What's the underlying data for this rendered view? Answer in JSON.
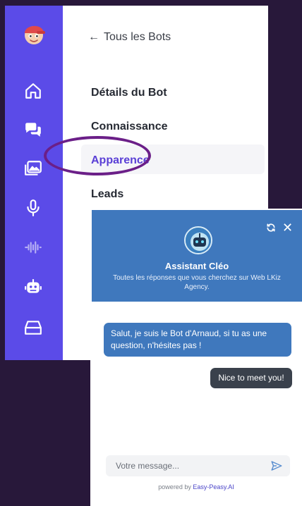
{
  "sidebar": {
    "icons": [
      "home-icon",
      "chat-bubbles-icon",
      "images-icon",
      "microphone-icon",
      "waveform-icon",
      "robot-icon",
      "inbox-icon"
    ]
  },
  "panel": {
    "back_label": "Tous les Bots",
    "menu": [
      {
        "label": "Détails du Bot"
      },
      {
        "label": "Connaissance"
      },
      {
        "label": "Apparence",
        "active": true
      },
      {
        "label": "Leads"
      }
    ]
  },
  "chat": {
    "bot_name": "Assistant Cléo",
    "bot_description": "Toutes les réponses que vous cherchez sur Web LKiz Agency.",
    "messages": [
      {
        "from": "bot",
        "text": "Salut, je suis le Bot d'Arnaud, si tu as une question, n'hésites pas !"
      },
      {
        "from": "user",
        "text": "Nice to meet you!"
      }
    ],
    "input_placeholder": "Votre message...",
    "powered_prefix": "powered by",
    "powered_brand": "Easy-Peasy.AI"
  },
  "colors": {
    "rail": "#5b4be8",
    "active_item": "#5a3fd6",
    "highlight_ring": "#6b1f88",
    "chat_header": "#3f78bd",
    "user_bubble": "#3a414c"
  }
}
